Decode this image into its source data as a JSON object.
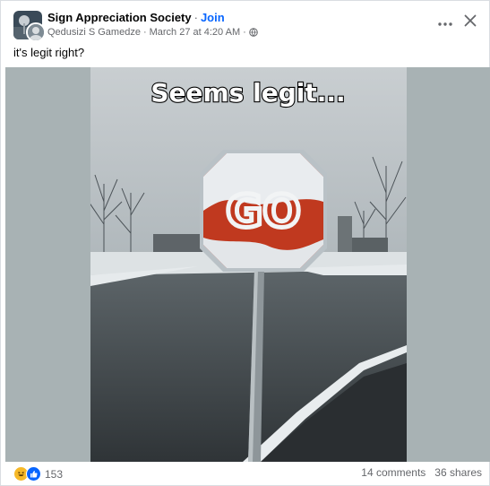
{
  "post": {
    "group_name": "Sign Appreciation Society",
    "join_label": "Join",
    "author": "Qedusizi S Gamedze",
    "timestamp": "March 27 at 4:20 AM",
    "caption": "it's legit right?"
  },
  "image": {
    "meme_caption": "Seems legit...",
    "sign_text": "GO"
  },
  "footer": {
    "reaction_count": "153",
    "comments": "14 comments",
    "shares": "36 shares"
  },
  "icons": {
    "more": "more-options-icon",
    "close": "close-icon",
    "privacy": "globe-icon",
    "reactions": [
      "haha-icon",
      "like-icon"
    ]
  },
  "colors": {
    "join": "#0866ff",
    "secondary_text": "#65676b",
    "like_blue": "#0866ff",
    "haha_yellow": "#f7b928",
    "stop_red": "#c0391f"
  }
}
